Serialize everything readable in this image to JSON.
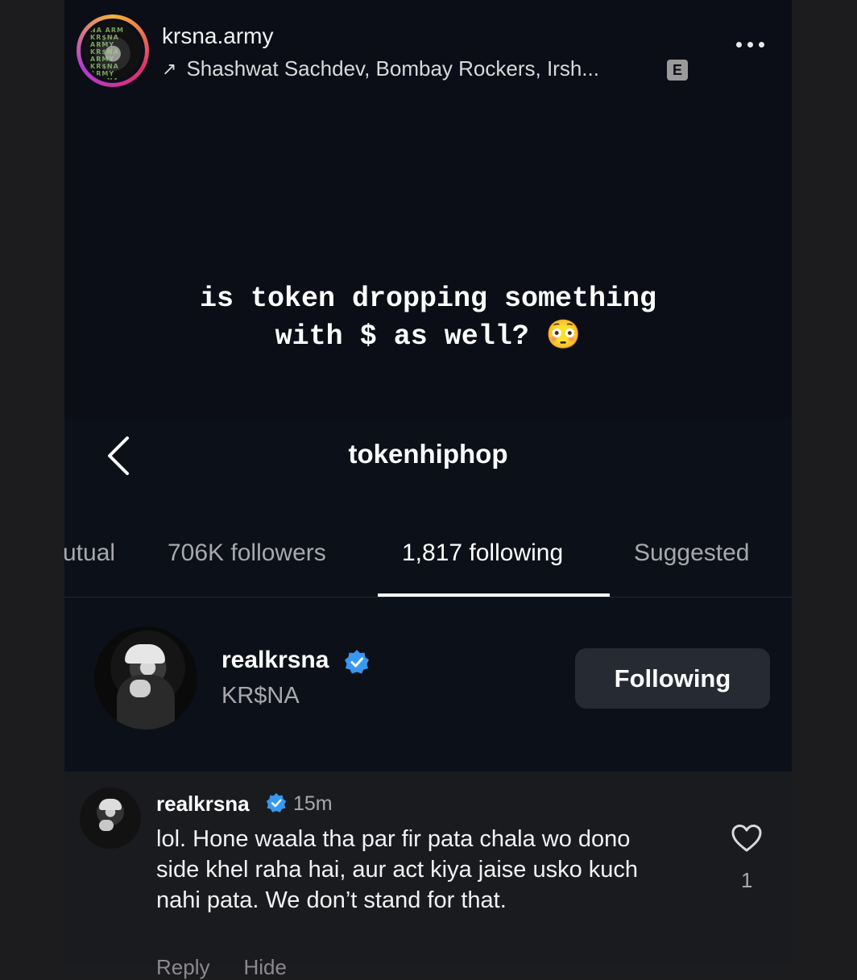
{
  "story": {
    "username": "krsna.army",
    "music_arrow": "↗",
    "music": "Shashwat Sachdev, Bombay Rockers, Irsh...",
    "explicit_badge": "E",
    "avatar_text": "NA ARM KR$NA ARMY KR$NA ARMY KR$NA ARMY KR$NA ARMY KR$NA ARMY",
    "caption": "is token dropping something\nwith $ as well? 😳"
  },
  "profile": {
    "title": "tokenhiphop",
    "tabs": [
      {
        "label": "utual"
      },
      {
        "label": "706K followers"
      },
      {
        "label": "1,817 following"
      },
      {
        "label": "Suggested"
      }
    ],
    "active_tab_index": 2,
    "list_user": {
      "username": "realkrsna",
      "full_name": "KR$NA",
      "button_label": "Following"
    }
  },
  "comment": {
    "username": "realkrsna",
    "time": "15m",
    "text": "lol. Hone waala tha par fir pata chala wo dono side khel raha hai, aur act kiya jaise usko kuch nahi pata. We don’t stand for that.",
    "like_count": "1",
    "reply_label": "Reply",
    "hide_label": "Hide"
  },
  "colors": {
    "panel_bg": "#0b0e17",
    "page_bg": "#1c1c1f",
    "verified_blue": "#3897f0",
    "button_bg": "#262a33",
    "muted_text": "#a8a8ad"
  },
  "icons": [
    "more-icon",
    "back-icon",
    "verified-icon",
    "heart-icon",
    "trending-arrow-icon"
  ]
}
